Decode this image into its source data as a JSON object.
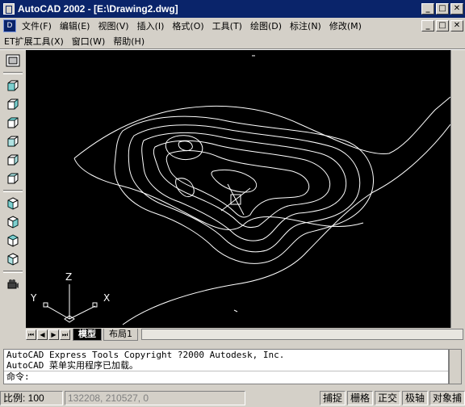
{
  "window": {
    "title": "AutoCAD 2002 - [E:\\Drawing2.dwg]",
    "controls": {
      "minimize": "_",
      "maximize": "□",
      "close": "✕"
    }
  },
  "menu_main": [
    "文件(F)",
    "编辑(E)",
    "视图(V)",
    "插入(I)",
    "格式(O)",
    "工具(T)",
    "绘图(D)",
    "标注(N)",
    "修改(M)"
  ],
  "menu_second": [
    "ET扩展工具(X)",
    "窗口(W)",
    "帮助(H)"
  ],
  "toolbar": {
    "icons": [
      "hide-render-icon",
      "box-view-top-icon",
      "box-view-bottom-icon",
      "box-view-left-icon",
      "box-view-right-icon",
      "box-view-front-icon",
      "box-view-back-icon",
      "iso-sw-icon",
      "iso-se-icon",
      "iso-ne-icon",
      "iso-nw-icon",
      "camera-icon"
    ]
  },
  "ucs": {
    "x_label": "X",
    "y_label": "Y",
    "z_label": "Z"
  },
  "layout_tabs": {
    "model": "模型",
    "layout1": "布局1"
  },
  "command_window": {
    "history": [
      "AutoCAD Express Tools Copyright ?2000 Autodesk, Inc.",
      "AutoCAD 菜单实用程序已加载。"
    ],
    "prompt": "命令:",
    "input_value": ""
  },
  "status": {
    "scale": "比例: 100",
    "coordinates": "132208, 210527, 0",
    "toggles": [
      "捕捉",
      "栅格",
      "正交",
      "极轴",
      "对象捕"
    ]
  },
  "colors": {
    "title_bar": "#0a246a",
    "canvas": "#000000",
    "chrome": "#d4d0c8",
    "drawing_lines": "#ffffff"
  }
}
